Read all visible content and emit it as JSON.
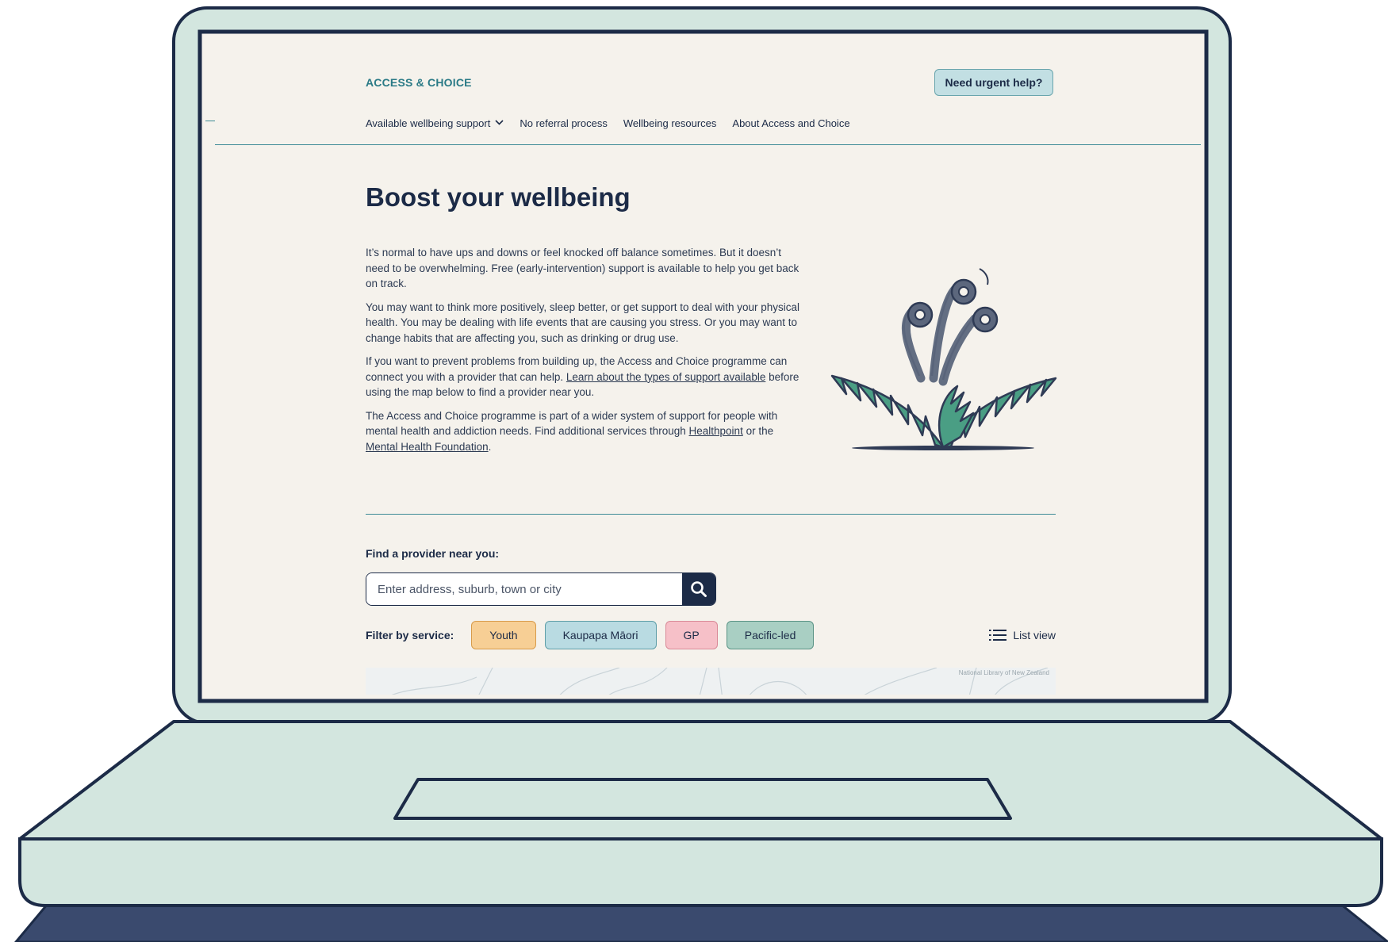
{
  "header": {
    "brand": "ACCESS & CHOICE",
    "urgent_button": "Need urgent help?"
  },
  "nav": {
    "items": [
      {
        "label": "Available wellbeing support",
        "has_dropdown": true
      },
      {
        "label": "No referral process"
      },
      {
        "label": "Wellbeing resources"
      },
      {
        "label": "About Access and Choice"
      }
    ]
  },
  "main": {
    "title": "Boost your wellbeing",
    "p1": "It’s normal to have ups and downs or feel knocked off balance sometimes. But it doesn’t need to be overwhelming. Free (early-intervention) support is available to help you get back on track.",
    "p2": "You may want to think more positively, sleep better, or get support to deal with your physical health. You may be dealing with life events that are causing you stress. Or you may want to change habits that are affecting you, such as drinking or drug use.",
    "p3_before": "If you want to prevent problems from building up, the Access and Choice programme can connect you with a provider that can help. ",
    "p3_link": "Learn about the types of support available",
    "p3_after": " before using the map below to find a provider near you.",
    "p4_before": "The Access and Choice programme is part of a wider system of support for people with mental health and addiction needs. Find additional services through ",
    "p4_link1": "Healthpoint",
    "p4_mid": " or the ",
    "p4_link2": "Mental Health Foundation",
    "p4_after": "."
  },
  "finder": {
    "label": "Find a provider near you:",
    "search_placeholder": "Enter address, suburb, town or city",
    "search_value": "",
    "filter_label": "Filter by service:",
    "filters": [
      {
        "label": "Youth",
        "bg": "#f7cf95",
        "border": "#d89b4a"
      },
      {
        "label": "Kaupapa Māori",
        "bg": "#b9dbe2",
        "border": "#5e9ea8"
      },
      {
        "label": "GP",
        "bg": "#f6c0c8",
        "border": "#d98a98"
      },
      {
        "label": "Pacific-led",
        "bg": "#a9cfc3",
        "border": "#5b9486"
      }
    ],
    "list_view": "List view",
    "map_credit": "National Library of New Zealand"
  },
  "colors": {
    "laptop_body": "#d3e6df",
    "laptop_outline": "#1c2b47",
    "laptop_base": "#3a4a6e",
    "screen_bg": "#f5f2ec",
    "accent_teal": "#2a7a86",
    "fern_green": "#4a9e84",
    "koru_grey": "#5c677d"
  }
}
